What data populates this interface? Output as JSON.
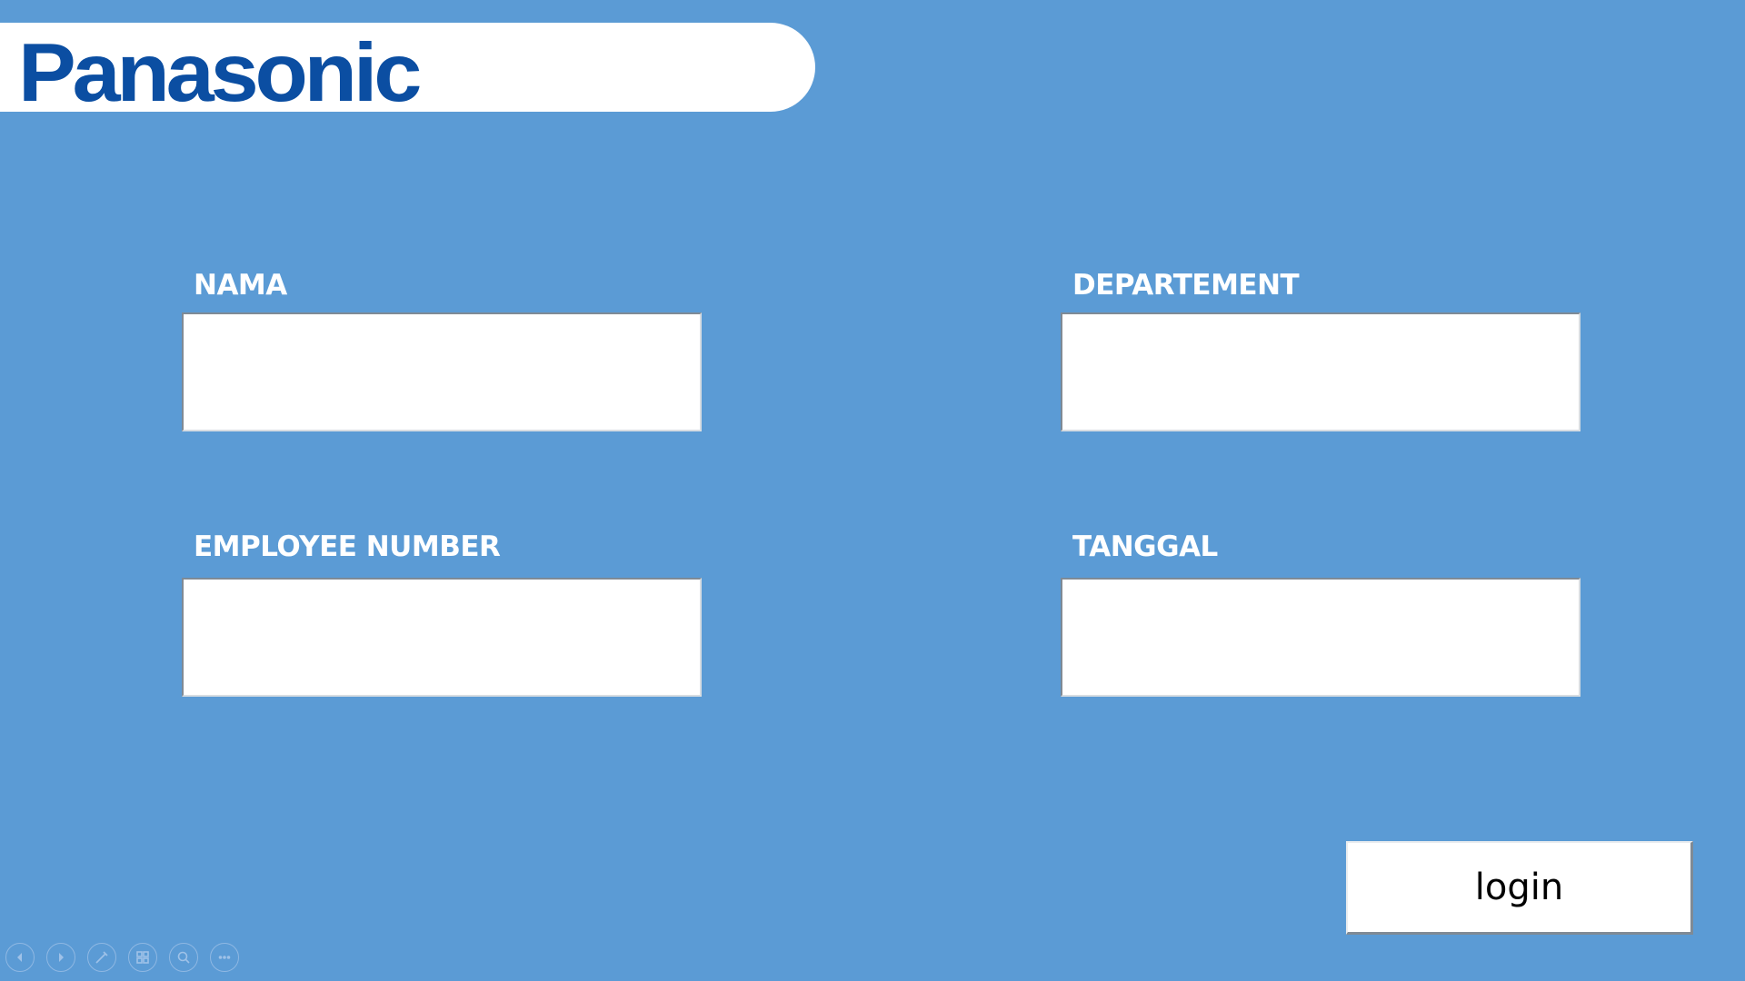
{
  "brand": {
    "logo_text": "Panasonic",
    "logo_color": "#0b4ea2"
  },
  "form": {
    "nama": {
      "label": "NAMA",
      "value": ""
    },
    "departement": {
      "label": "DEPARTEMENT",
      "value": ""
    },
    "employee_number": {
      "label": "EMPLOYEE NUMBER",
      "value": ""
    },
    "tanggal": {
      "label": "TANGGAL",
      "value": ""
    },
    "login_label": "login"
  },
  "theme": {
    "background": "#5b9bd5",
    "field_background": "#ffffff",
    "label_color": "#ffffff"
  },
  "slideshow_toolbar": {
    "icons": [
      "previous-icon",
      "next-icon",
      "pen-icon",
      "slides-icon",
      "zoom-icon",
      "more-icon"
    ]
  }
}
